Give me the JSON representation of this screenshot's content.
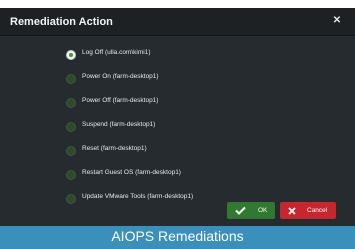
{
  "dialog": {
    "title": "Remediation Action",
    "close_icon": "close-icon",
    "options": [
      {
        "label": "Log Off (ulla.com\\kimi1)",
        "checked": true
      },
      {
        "label": "Power On (farm-desktop1)",
        "checked": false
      },
      {
        "label": "Power Off (farm-desktop1)",
        "checked": false
      },
      {
        "label": "Suspend (farm-desktop1)",
        "checked": false
      },
      {
        "label": "Reset (farm-desktop1)",
        "checked": false
      },
      {
        "label": "Restart Guest OS (farm-desktop1)",
        "checked": false
      },
      {
        "label": "Update VMware Tools (farm-desktop1)",
        "checked": false
      }
    ],
    "ok_label": "OK",
    "cancel_label": "Cancel"
  },
  "footer": {
    "caption": "AIOPS Remediations"
  },
  "colors": {
    "dialog_bg": "#262b2f",
    "header_bg": "#1d2124",
    "ok_green": "#2f7a2f",
    "cancel_red": "#c8262e",
    "footer_blue": "#3b8fbb"
  }
}
